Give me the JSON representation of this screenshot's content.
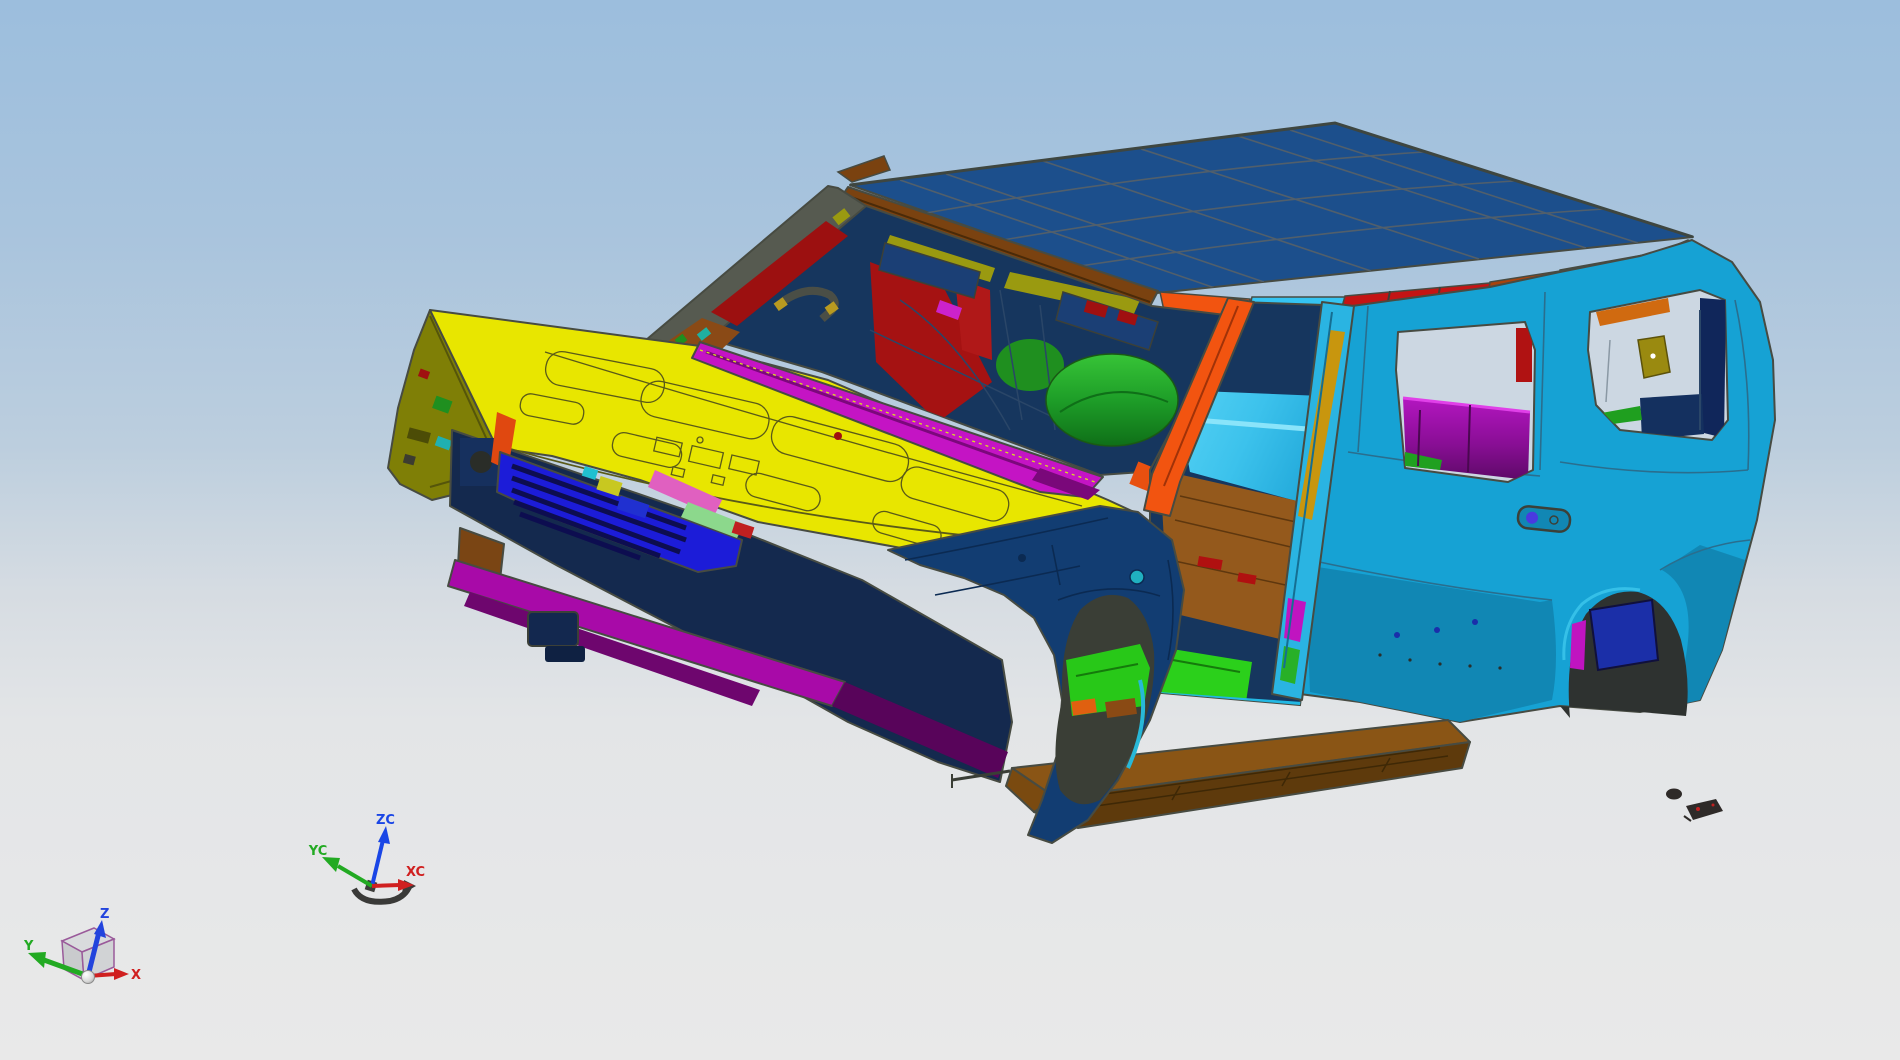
{
  "viewport": {
    "type": "cad-3d-viewport",
    "background_top": "#9cbedd",
    "background_bottom": "#e9e9e9",
    "wcs_triad": {
      "labels": {
        "z": "ZC",
        "y": "YC",
        "x": "XC"
      },
      "colors": {
        "z": "#1a46e6",
        "y": "#22aa22",
        "x": "#d02020"
      }
    },
    "view_triad": {
      "labels": {
        "z": "Z",
        "y": "Y",
        "x": "X"
      },
      "colors": {
        "z": "#2244dd",
        "y": "#22aa22",
        "x": "#d02020"
      }
    }
  },
  "model": {
    "description": "multi-colored body-in-white SUV assembly",
    "parts": [
      {
        "name": "hood-outer-panel",
        "color": "#e8e600"
      },
      {
        "name": "roof-panel",
        "color": "#1c4f8c"
      },
      {
        "name": "windshield-header",
        "color": "#7a4210"
      },
      {
        "name": "body-side-outer",
        "color": "#16a2d4"
      },
      {
        "name": "rear-quarter-lower",
        "color": "#1187b4"
      },
      {
        "name": "front-fender",
        "color": "#123d72"
      },
      {
        "name": "fender-apron",
        "color": "#7f7f06"
      },
      {
        "name": "a-pillar-brace",
        "color": "#f25410"
      },
      {
        "name": "cowl-panel",
        "color": "#c414c4"
      },
      {
        "name": "radiator-support",
        "color": "#1c1cd8"
      },
      {
        "name": "bumper-beam",
        "color": "#a80aa8"
      },
      {
        "name": "floor-pan",
        "color": "#2bd01b"
      },
      {
        "name": "tunnel-floor",
        "color": "#94591c"
      },
      {
        "name": "running-board",
        "color": "#7a4a12"
      },
      {
        "name": "door-inner-panel",
        "color": "#a51212"
      },
      {
        "name": "b-pillar-reinforcement",
        "color": "#c8960e"
      },
      {
        "name": "interior-trim-panel",
        "color": "#8a0e96"
      },
      {
        "name": "wheelhouse",
        "color": "#1e9e28"
      },
      {
        "name": "spring-seat-box",
        "color": "#1b2fa8"
      }
    ]
  }
}
